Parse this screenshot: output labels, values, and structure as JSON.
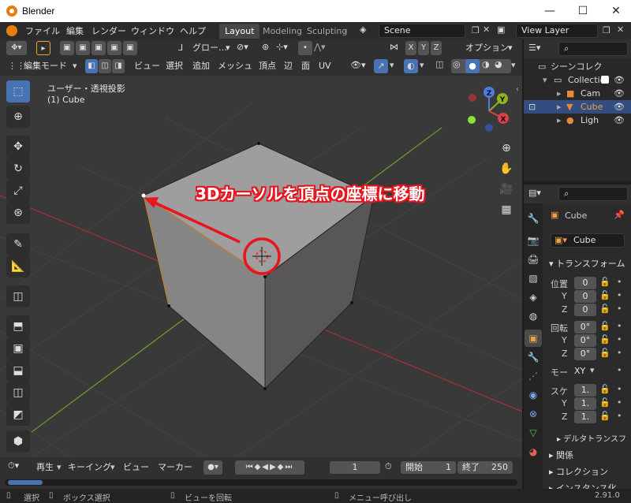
{
  "window": {
    "title": "Blender",
    "minimize": "—",
    "maximize": "☐",
    "close": "✕"
  },
  "menubar": {
    "items": [
      "ファイル",
      "編集",
      "レンダー",
      "ウィンドウ",
      "ヘルプ"
    ],
    "tabs": [
      "Layout",
      "Modeling",
      "Sculpting"
    ],
    "active_tab": "Layout",
    "scene": "Scene",
    "view_layer": "View Layer"
  },
  "viewport_header": {
    "mode": "編集モード",
    "menus": [
      "ビュー",
      "選択",
      "追加",
      "メッシュ",
      "頂点",
      "辺",
      "面",
      "UV"
    ],
    "orientation": "グロー…",
    "axes": [
      "X",
      "Y",
      "Z"
    ],
    "options": "オプション"
  },
  "viewport": {
    "view_name": "ユーザー・透視投影",
    "object_name": "(1) Cube",
    "annotation": "3Dカーソルを頂点の座標に移動",
    "gizmo": [
      "X",
      "Y",
      "Z"
    ]
  },
  "outliner": {
    "title": "シーンコレク",
    "rows": [
      "Collectio",
      "Cam",
      "Cube",
      "Ligh"
    ]
  },
  "properties": {
    "object": "Cube",
    "datablock": "Cube",
    "transform_header": "トランスフォーム",
    "location_label": "位置",
    "location": [
      "0",
      "0",
      "0"
    ],
    "rotation_label": "回転",
    "rotation": [
      "0°",
      "0°",
      "0°"
    ],
    "mode_label": "モー",
    "mode_value": "XY",
    "scale_label": "スケ",
    "scale": [
      "1.",
      "1.",
      "1."
    ],
    "axis_labels": [
      "X",
      "Y",
      "Z"
    ],
    "delta": "デルタトランスフ",
    "relations": "関係",
    "collections": "コレクション",
    "instancing": "インスタンス化"
  },
  "timeline": {
    "playback": "再生",
    "keying": "キーイング",
    "view": "ビュー",
    "marker": "マーカー",
    "current_frame": "1",
    "start_label": "開始",
    "start": "1",
    "end_label": "終了",
    "end": "250"
  },
  "statusbar": {
    "select": "選択",
    "box_select": "ボックス選択",
    "rotate_view": "ビューを回転",
    "call_menu": "メニュー呼び出し",
    "version": "2.91.0"
  },
  "colors": {
    "accent": "#4772b3",
    "annotation": "#e8141e",
    "header": "#303030",
    "viewport": "#393939"
  }
}
